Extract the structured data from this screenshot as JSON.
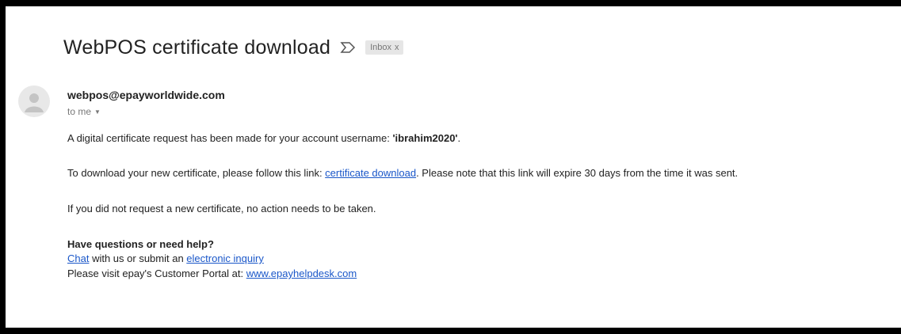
{
  "email": {
    "subject": "WebPOS certificate download",
    "label": "Inbox",
    "label_close": "x",
    "sender": "webpos@epayworldwide.com",
    "to": "to me",
    "line1_prefix": "A digital certificate request has been made for your account username: ",
    "line1_username": "'ibrahim2020'",
    "line1_suffix": ".",
    "line2_prefix": "To download your new certificate, please follow this link: ",
    "line2_link": "certificate download",
    "line2_suffix": ". Please note that this link will expire 30 days from the time it was sent.",
    "line3": "If you did not request a new certificate, no action needs to be taken.",
    "help_heading": "Have questions or need help?",
    "help_chat_link": "Chat",
    "help_middle": " with us or submit an ",
    "help_inquiry_link": "electronic inquiry",
    "help_portal_prefix": "Please visit epay's Customer Portal at: ",
    "help_portal_link": "www.epayhelpdesk.com"
  },
  "icons": {
    "important": "important-marker-icon",
    "avatar": "default-avatar-icon",
    "caret": "chevron-down-icon"
  }
}
